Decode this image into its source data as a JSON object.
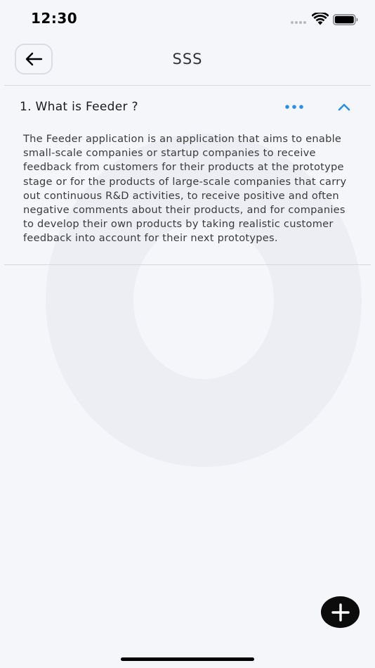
{
  "status_bar": {
    "time": "12:30",
    "icons": [
      "signal-dots-icon",
      "wifi-icon",
      "battery-icon"
    ]
  },
  "header": {
    "title": "SSS",
    "back_icon": "arrow-left-icon"
  },
  "faq": [
    {
      "question": "1. What is Feeder ?",
      "answer": "The Feeder application is an application that aims to enable small-scale companies or startup companies to receive feedback from customers for their products at the prototype stage or for the products of large-scale companies that carry out continuous R&D activities, to receive positive and often negative comments about their products, and for companies to develop their own products by taking realistic customer feedback into account for their next prototypes.",
      "expanded": true,
      "more_icon": "more-horizontal-icon",
      "toggle_icon": "chevron-up-icon"
    }
  ],
  "fab": {
    "icon": "plus-icon"
  },
  "colors": {
    "background": "#f5f6fa",
    "accent": "#2a8fdf",
    "fab": "#0c0c0c",
    "divider": "#d6d7db"
  }
}
